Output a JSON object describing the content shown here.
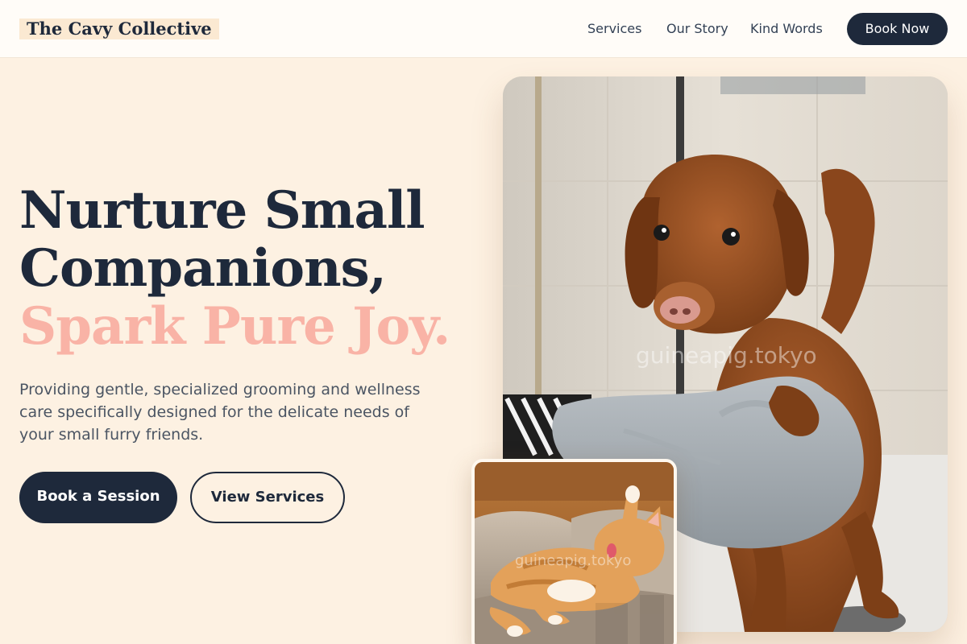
{
  "header": {
    "logo": "The Cavy Collective",
    "nav": {
      "services": "Services",
      "story": "Our Story",
      "words": "Kind Words"
    },
    "cta": "Book Now"
  },
  "hero": {
    "title_line1": "Nurture Small",
    "title_line2": "Companions,",
    "title_accent": "Spark Pure Joy.",
    "description": "Providing gentle, specialized grooming and wellness care specifically designed for the delicate needs of your small furry friends.",
    "primary_button": "Book a Session",
    "secondary_button": "View Services"
  },
  "images": {
    "main_watermark": "guineapig.tokyo",
    "small_watermark": "guineapig.tokyo"
  },
  "colors": {
    "background": "#fdf1e2",
    "navy": "#1e293b",
    "accent_pink": "#f9b3a6"
  }
}
